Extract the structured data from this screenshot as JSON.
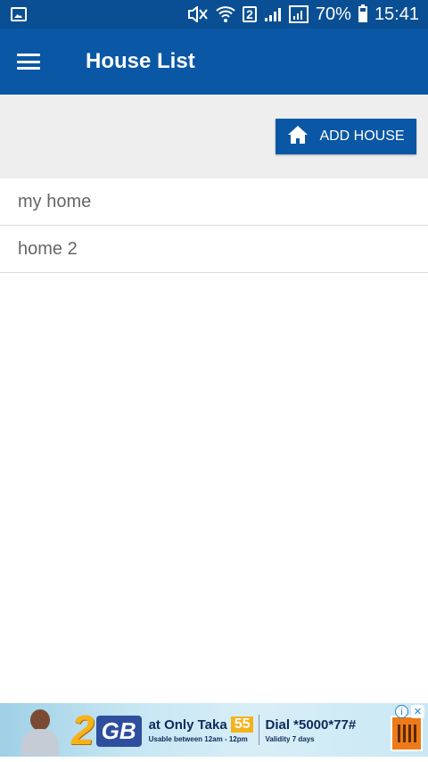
{
  "status_bar": {
    "icons": [
      "gallery-icon",
      "mute-icon",
      "wifi-icon",
      "sim-badge-icon",
      "signal-icon",
      "signal-alt-icon",
      "battery-icon"
    ],
    "sim_badge": "2",
    "battery": "70%",
    "time": "15:41"
  },
  "app_bar": {
    "title": "House List",
    "menu_icon": "hamburger-menu-icon"
  },
  "toolbar": {
    "add_house_label": "ADD HOUSE",
    "add_house_icon": "home-icon"
  },
  "houses": [
    {
      "name": "my home"
    },
    {
      "name": "home 2"
    }
  ],
  "ad": {
    "big_number": "2",
    "big_unit": "GB",
    "offer_text": "at Only Taka",
    "price": "55",
    "usage_text": "Usable between 12am - 12pm",
    "dial_text": "Dial *5000*77#",
    "validity_text": "Validity 7 days",
    "choices": {
      "info": "i",
      "close": "✕"
    }
  },
  "colors": {
    "status_bar": "#0a4f93",
    "app_bar": "#0a57a5",
    "toolbar_bg": "#eeeeee",
    "button_bg": "#0a57a5",
    "list_text": "#666666",
    "divider": "#dcdcdc"
  }
}
